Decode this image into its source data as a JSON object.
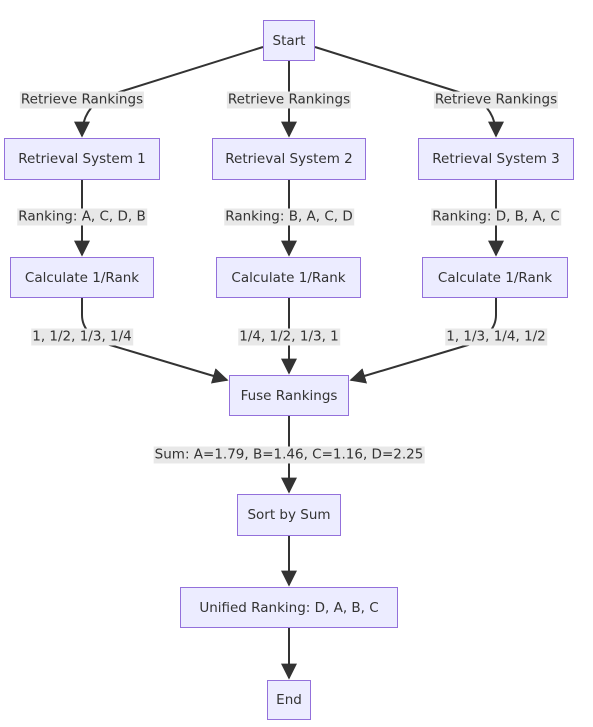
{
  "colors": {
    "node_fill": "#ECECFF",
    "node_stroke": "#9370DB",
    "edge": "#333333",
    "edge_label_bg": "#e8e8e8"
  },
  "nodes": {
    "start": "Start",
    "rs1": "Retrieval System 1",
    "rs2": "Retrieval System 2",
    "rs3": "Retrieval System 3",
    "calc1": "Calculate 1/Rank",
    "calc2": "Calculate 1/Rank",
    "calc3": "Calculate 1/Rank",
    "fuse": "Fuse Rankings",
    "sort": "Sort by Sum",
    "unified": "Unified Ranking: D, A, B, C",
    "end": "End"
  },
  "edge_labels": {
    "retrieve1": "Retrieve Rankings",
    "retrieve2": "Retrieve Rankings",
    "retrieve3": "Retrieve Rankings",
    "ranking1": "Ranking: A, C, D, B",
    "ranking2": "Ranking: B, A, C, D",
    "ranking3": "Ranking: D, B, A, C",
    "values1": "1, 1/2, 1/3, 1/4",
    "values2": "1/4, 1/2, 1/3, 1",
    "values3": "1, 1/3, 1/4, 1/2",
    "sum": "Sum: A=1.79, B=1.46, C=1.16, D=2.25"
  }
}
